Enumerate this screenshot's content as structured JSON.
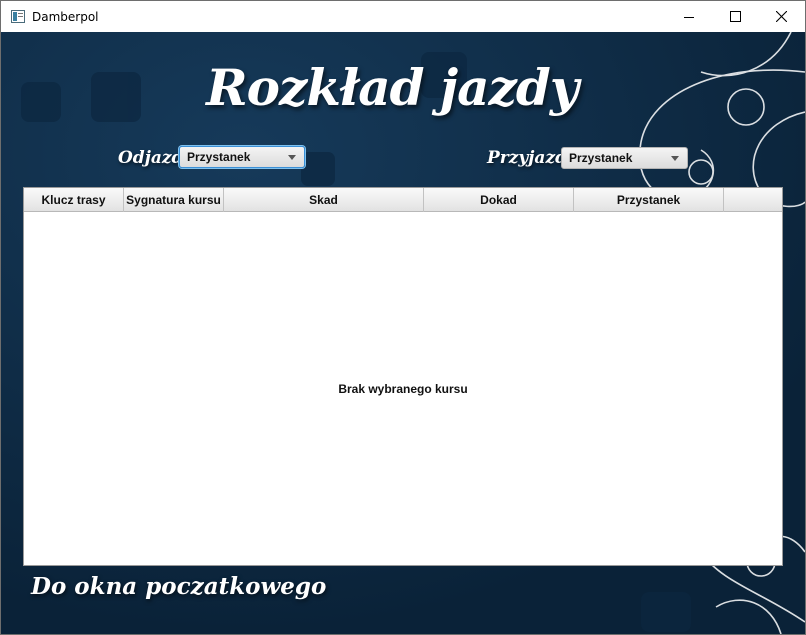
{
  "window": {
    "title": "Damberpol",
    "controls": {
      "minimize_icon": "minimize-icon",
      "maximize_icon": "maximize-icon",
      "close_icon": "close-icon"
    }
  },
  "header": {
    "title": "Rozkład jazdy"
  },
  "filters": {
    "departure": {
      "label": "Odjazd",
      "selected": "Przystanek"
    },
    "arrival": {
      "label": "Przyjazd",
      "selected": "Przystanek"
    }
  },
  "table": {
    "columns": [
      "Klucz trasy",
      "Sygnatura kursu",
      "Skad",
      "Dokad",
      "Przystanek",
      ""
    ],
    "placeholder": "Brak wybranego kursu"
  },
  "footer": {
    "back_link": "Do okna poczatkowego"
  },
  "colors": {
    "background": "#0e2b45",
    "accent_focus": "#3a8fd6",
    "text_light": "#ffffff"
  }
}
